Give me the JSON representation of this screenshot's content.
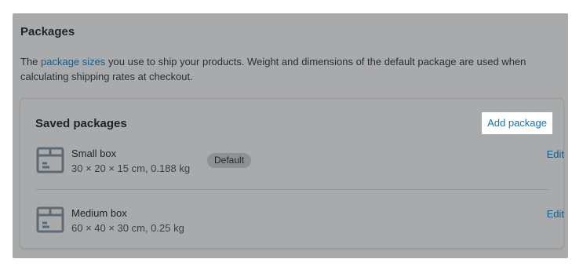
{
  "section": {
    "title": "Packages",
    "description_prefix": "The ",
    "description_link": "package sizes",
    "description_suffix": " you use to ship your products. Weight and dimensions of the default package are used when calculating shipping rates at checkout."
  },
  "saved": {
    "title": "Saved packages",
    "add_label": "Add package",
    "packages": [
      {
        "name": "Small box",
        "dims": "30 × 20 × 15 cm, 0.188 kg",
        "badge": "Default",
        "edit_label": "Edit"
      },
      {
        "name": "Medium box",
        "dims": "60 × 40 × 30 cm, 0.25 kg",
        "edit_label": "Edit"
      }
    ]
  },
  "colors": {
    "overlay": "#a9aaab",
    "link": "#1d5c86",
    "icon": "#5d6a76"
  },
  "icons": {
    "package": "box-icon"
  }
}
